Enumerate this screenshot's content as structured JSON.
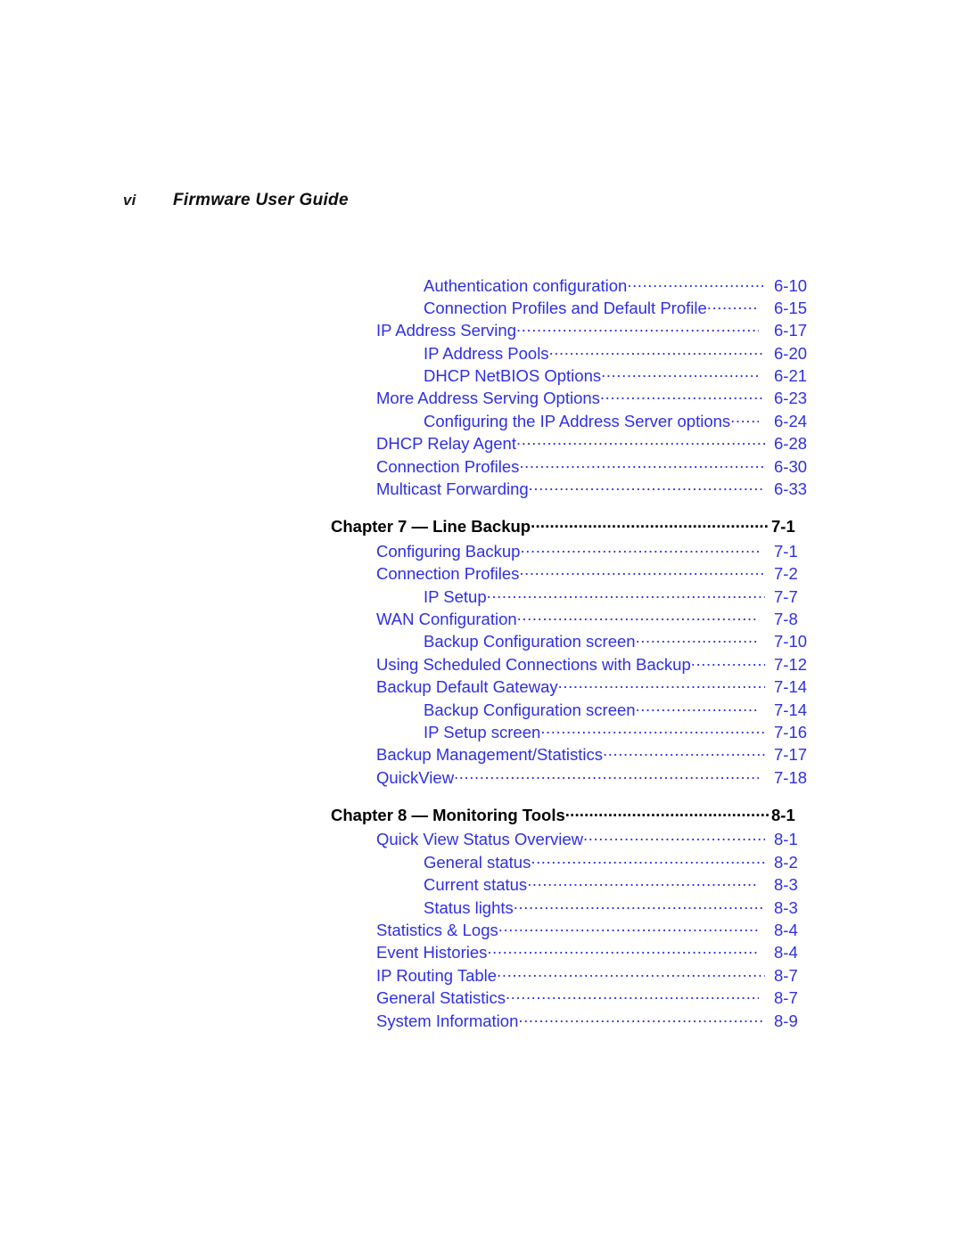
{
  "header": {
    "folio": "vi",
    "title": "Firmware User Guide"
  },
  "toc": {
    "entries": [
      {
        "level": 2,
        "label": "Authentication configuration",
        "page": "6-10",
        "gap": "none"
      },
      {
        "level": 2,
        "label": "Connection Profiles and Default Profile",
        "page": "6-15",
        "gap": "wide"
      },
      {
        "level": 1,
        "label": "IP Address Serving",
        "page": "6-17",
        "gap": "wide"
      },
      {
        "level": 2,
        "label": "IP Address Pools",
        "page": "6-20",
        "gap": "none"
      },
      {
        "level": 2,
        "label": "DHCP NetBIOS Options",
        "page": "6-21",
        "gap": "wide"
      },
      {
        "level": 1,
        "label": "More Address Serving Options",
        "page": "6-23",
        "gap": "none"
      },
      {
        "level": 2,
        "label": "Configuring the IP Address Server options",
        "page": "6-24",
        "gap": "wide"
      },
      {
        "level": 1,
        "label": "DHCP Relay Agent",
        "page": "6-28",
        "gap": "none"
      },
      {
        "level": 1,
        "label": "Connection Profiles",
        "page": "6-30",
        "gap": "none"
      },
      {
        "level": 1,
        "label": "Multicast Forwarding",
        "page": "6-33",
        "gap": "none"
      },
      {
        "level": 0,
        "label": "Chapter 7 — Line Backup",
        "page": "7-1",
        "gap": "none"
      },
      {
        "level": 1,
        "label": "Configuring Backup",
        "page": "7-1",
        "gap": "wide"
      },
      {
        "level": 1,
        "label": "Connection Profiles",
        "page": "7-2",
        "gap": "none"
      },
      {
        "level": 2,
        "label": "IP Setup",
        "page": "7-7",
        "gap": "none"
      },
      {
        "level": 1,
        "label": "WAN Configuration",
        "page": "7-8",
        "gap": "wide"
      },
      {
        "level": 2,
        "label": "Backup Configuration screen",
        "page": "7-10",
        "gap": "wide"
      },
      {
        "level": 1,
        "label": "Using Scheduled Connections with Backup",
        "page": "7-12",
        "gap": "none"
      },
      {
        "level": 1,
        "label": "Backup Default Gateway",
        "page": "7-14",
        "gap": "none"
      },
      {
        "level": 2,
        "label": "Backup Configuration screen",
        "page": "7-14",
        "gap": "wide"
      },
      {
        "level": 2,
        "label": "IP Setup screen",
        "page": "7-16",
        "gap": "none"
      },
      {
        "level": 1,
        "label": "Backup Management/Statistics",
        "page": "7-17",
        "gap": "none"
      },
      {
        "level": 1,
        "label": "QuickView",
        "page": "7-18",
        "gap": "wide"
      },
      {
        "level": 0,
        "label": "Chapter 8 — Monitoring Tools",
        "page": "8-1",
        "gap": "none"
      },
      {
        "level": 1,
        "label": "Quick View Status Overview",
        "page": "8-1",
        "gap": "none"
      },
      {
        "level": 2,
        "label": "General status",
        "page": "8-2",
        "gap": "none"
      },
      {
        "level": 2,
        "label": "Current status",
        "page": "8-3",
        "gap": "wide"
      },
      {
        "level": 2,
        "label": "Status lights",
        "page": "8-3",
        "gap": "none"
      },
      {
        "level": 1,
        "label": "Statistics & Logs",
        "page": "8-4",
        "gap": "wide"
      },
      {
        "level": 1,
        "label": "Event Histories",
        "page": "8-4",
        "gap": "wide"
      },
      {
        "level": 1,
        "label": "IP Routing Table",
        "page": "8-7",
        "gap": "none"
      },
      {
        "level": 1,
        "label": "General Statistics",
        "page": "8-7",
        "gap": "wide"
      },
      {
        "level": 1,
        "label": "System Information",
        "page": "8-9",
        "gap": "none"
      }
    ]
  },
  "colors": {
    "link_blue": "#2f2fe6",
    "chapter_black": "#000000",
    "page_background": "#ffffff"
  }
}
